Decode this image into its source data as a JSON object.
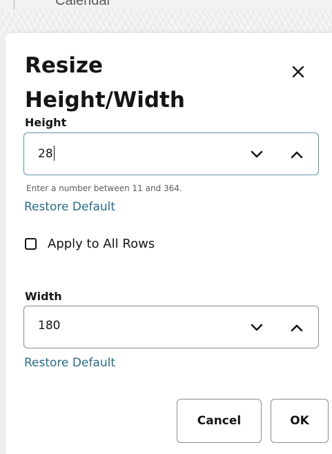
{
  "background": {
    "partial_text": "Calendar"
  },
  "dialog": {
    "title": "Resize Height/Width",
    "close_icon": "close-icon",
    "height": {
      "label": "Height",
      "value": "28",
      "help": "Enter a number between 11 and 364.",
      "restore_label": "Restore Default"
    },
    "apply_all": {
      "label": "Apply to All Rows",
      "checked": false
    },
    "width": {
      "label": "Width",
      "value": "180",
      "restore_label": "Restore Default"
    },
    "buttons": {
      "cancel_label": "Cancel",
      "ok_label": "OK"
    }
  },
  "colors": {
    "text": "#161513",
    "link": "#2a6b85",
    "focus_border": "#5c94a8",
    "border": "#8e8b86"
  }
}
